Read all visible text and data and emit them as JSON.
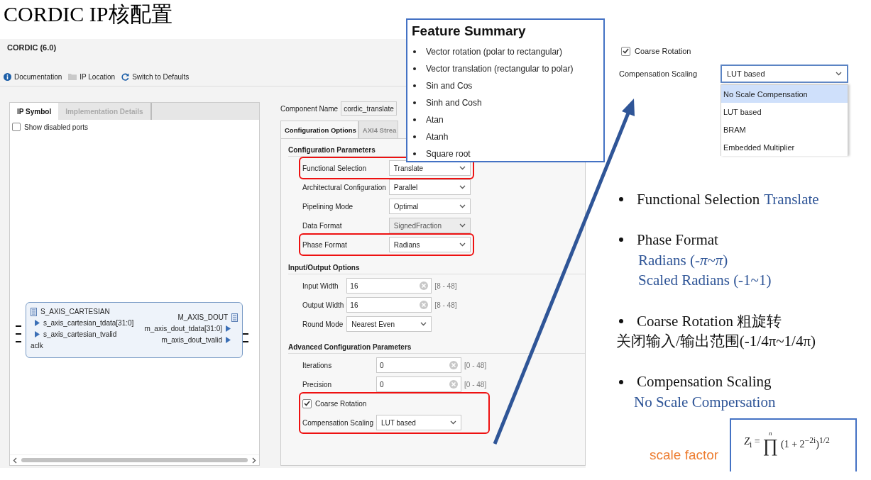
{
  "slide": {
    "title": "CORDIC IP核配置"
  },
  "ip_window": {
    "title": "CORDIC (6.0)",
    "toolbar": [
      {
        "kind": "info",
        "label": "Documentation"
      },
      {
        "kind": "folder",
        "label": "IP Location"
      },
      {
        "kind": "refresh",
        "label": "Switch to Defaults"
      }
    ],
    "left_tabs": [
      {
        "label": "IP Symbol",
        "selected": true
      },
      {
        "label": "Implementation Details",
        "selected": false
      }
    ],
    "show_disabled_ports": {
      "label": "Show disabled ports",
      "checked": false
    },
    "symbol": {
      "input_bus": "S_AXIS_CARTESIAN",
      "inputs": [
        "s_axis_cartesian_tdata[31:0]",
        "s_axis_cartesian_tvalid"
      ],
      "clock": "aclk",
      "output_bus": "M_AXIS_DOUT",
      "outputs": [
        "m_axis_dout_tdata[31:0]",
        "m_axis_dout_tvalid"
      ]
    },
    "component_name": {
      "label": "Component Name",
      "value": "cordic_translate"
    },
    "right_tabs": [
      {
        "label": "Configuration Options",
        "selected": true
      },
      {
        "label": "AXI4 Strea",
        "selected": false
      }
    ],
    "sections": [
      {
        "title": "Configuration Parameters",
        "fields": [
          {
            "kind": "select",
            "label": "Functional Selection",
            "value": "Translate",
            "disabled": false,
            "highlighted": true
          },
          {
            "kind": "select",
            "label": "Architectural Configuration",
            "value": "Parallel",
            "disabled": false,
            "highlighted": false
          },
          {
            "kind": "select",
            "label": "Pipelining Mode",
            "value": "Optimal",
            "disabled": false,
            "highlighted": false
          },
          {
            "kind": "select",
            "label": "Data Format",
            "value": "SignedFraction",
            "disabled": true,
            "highlighted": false
          },
          {
            "kind": "select",
            "label": "Phase Format",
            "value": "Radians",
            "disabled": false,
            "highlighted": true
          }
        ]
      },
      {
        "title": "Input/Output Options",
        "fields": [
          {
            "kind": "text",
            "label": "Input Width",
            "value": "16",
            "range": "[8 - 48]"
          },
          {
            "kind": "text",
            "label": "Output Width",
            "value": "16",
            "range": "[8 - 48]"
          },
          {
            "kind": "select",
            "label": "Round Mode",
            "value": "Nearest Even",
            "disabled": false
          }
        ]
      },
      {
        "title": "Advanced Configuration Parameters",
        "fields": [
          {
            "kind": "text",
            "label": "Iterations",
            "value": "0",
            "range": "[0 - 48]"
          },
          {
            "kind": "text",
            "label": "Precision",
            "value": "0",
            "range": "[0 - 48]"
          },
          {
            "kind": "group",
            "highlighted": true,
            "fields": [
              {
                "kind": "checkbox",
                "label": "Coarse Rotation",
                "checked": true
              },
              {
                "kind": "select",
                "label": "Compensation Scaling",
                "value": "LUT based",
                "disabled": false
              }
            ]
          }
        ]
      }
    ]
  },
  "feature_summary": {
    "title": "Feature Summary",
    "items": [
      "Vector rotation (polar to rectangular)",
      "Vector translation (rectangular to polar)",
      "Sin and Cos",
      "Sinh and Cosh",
      "Atan",
      "Atanh",
      "Square root"
    ]
  },
  "dropdown_detail": {
    "checkbox": {
      "label": "Coarse Rotation",
      "checked": true
    },
    "label": "Compensation Scaling",
    "value": "LUT based",
    "options": [
      {
        "label": "No Scale Compensation",
        "highlighted": true
      },
      {
        "label": "LUT based",
        "highlighted": false
      },
      {
        "label": "BRAM",
        "highlighted": false
      },
      {
        "label": "Embedded Multiplier",
        "highlighted": false
      }
    ]
  },
  "notes": [
    {
      "heading": "Functional Selection",
      "heading_value": "Translate"
    },
    {
      "heading": "Phase Format",
      "details": [
        {
          "kind": "value",
          "text": "Radians (-*π*~*π*)"
        },
        {
          "kind": "value",
          "text": "Scaled Radians (-1~1)"
        }
      ]
    },
    {
      "heading": "Coarse Rotation 粗旋转",
      "details": [
        {
          "kind": "plain",
          "text": "关闭输入/输出范围(-1/4π~1/4π)"
        }
      ]
    },
    {
      "heading": "Compensation Scaling",
      "details": [
        {
          "kind": "value",
          "text": "No Scale Compersation"
        }
      ]
    }
  ],
  "scale_factor": {
    "label": "scale factor",
    "lhs": "*Z*$_{i}$ =",
    "product_upper": "n",
    "product": "∏",
    "rhs": "(1 + 2$^{−2i}$)$^{1/2}$"
  }
}
